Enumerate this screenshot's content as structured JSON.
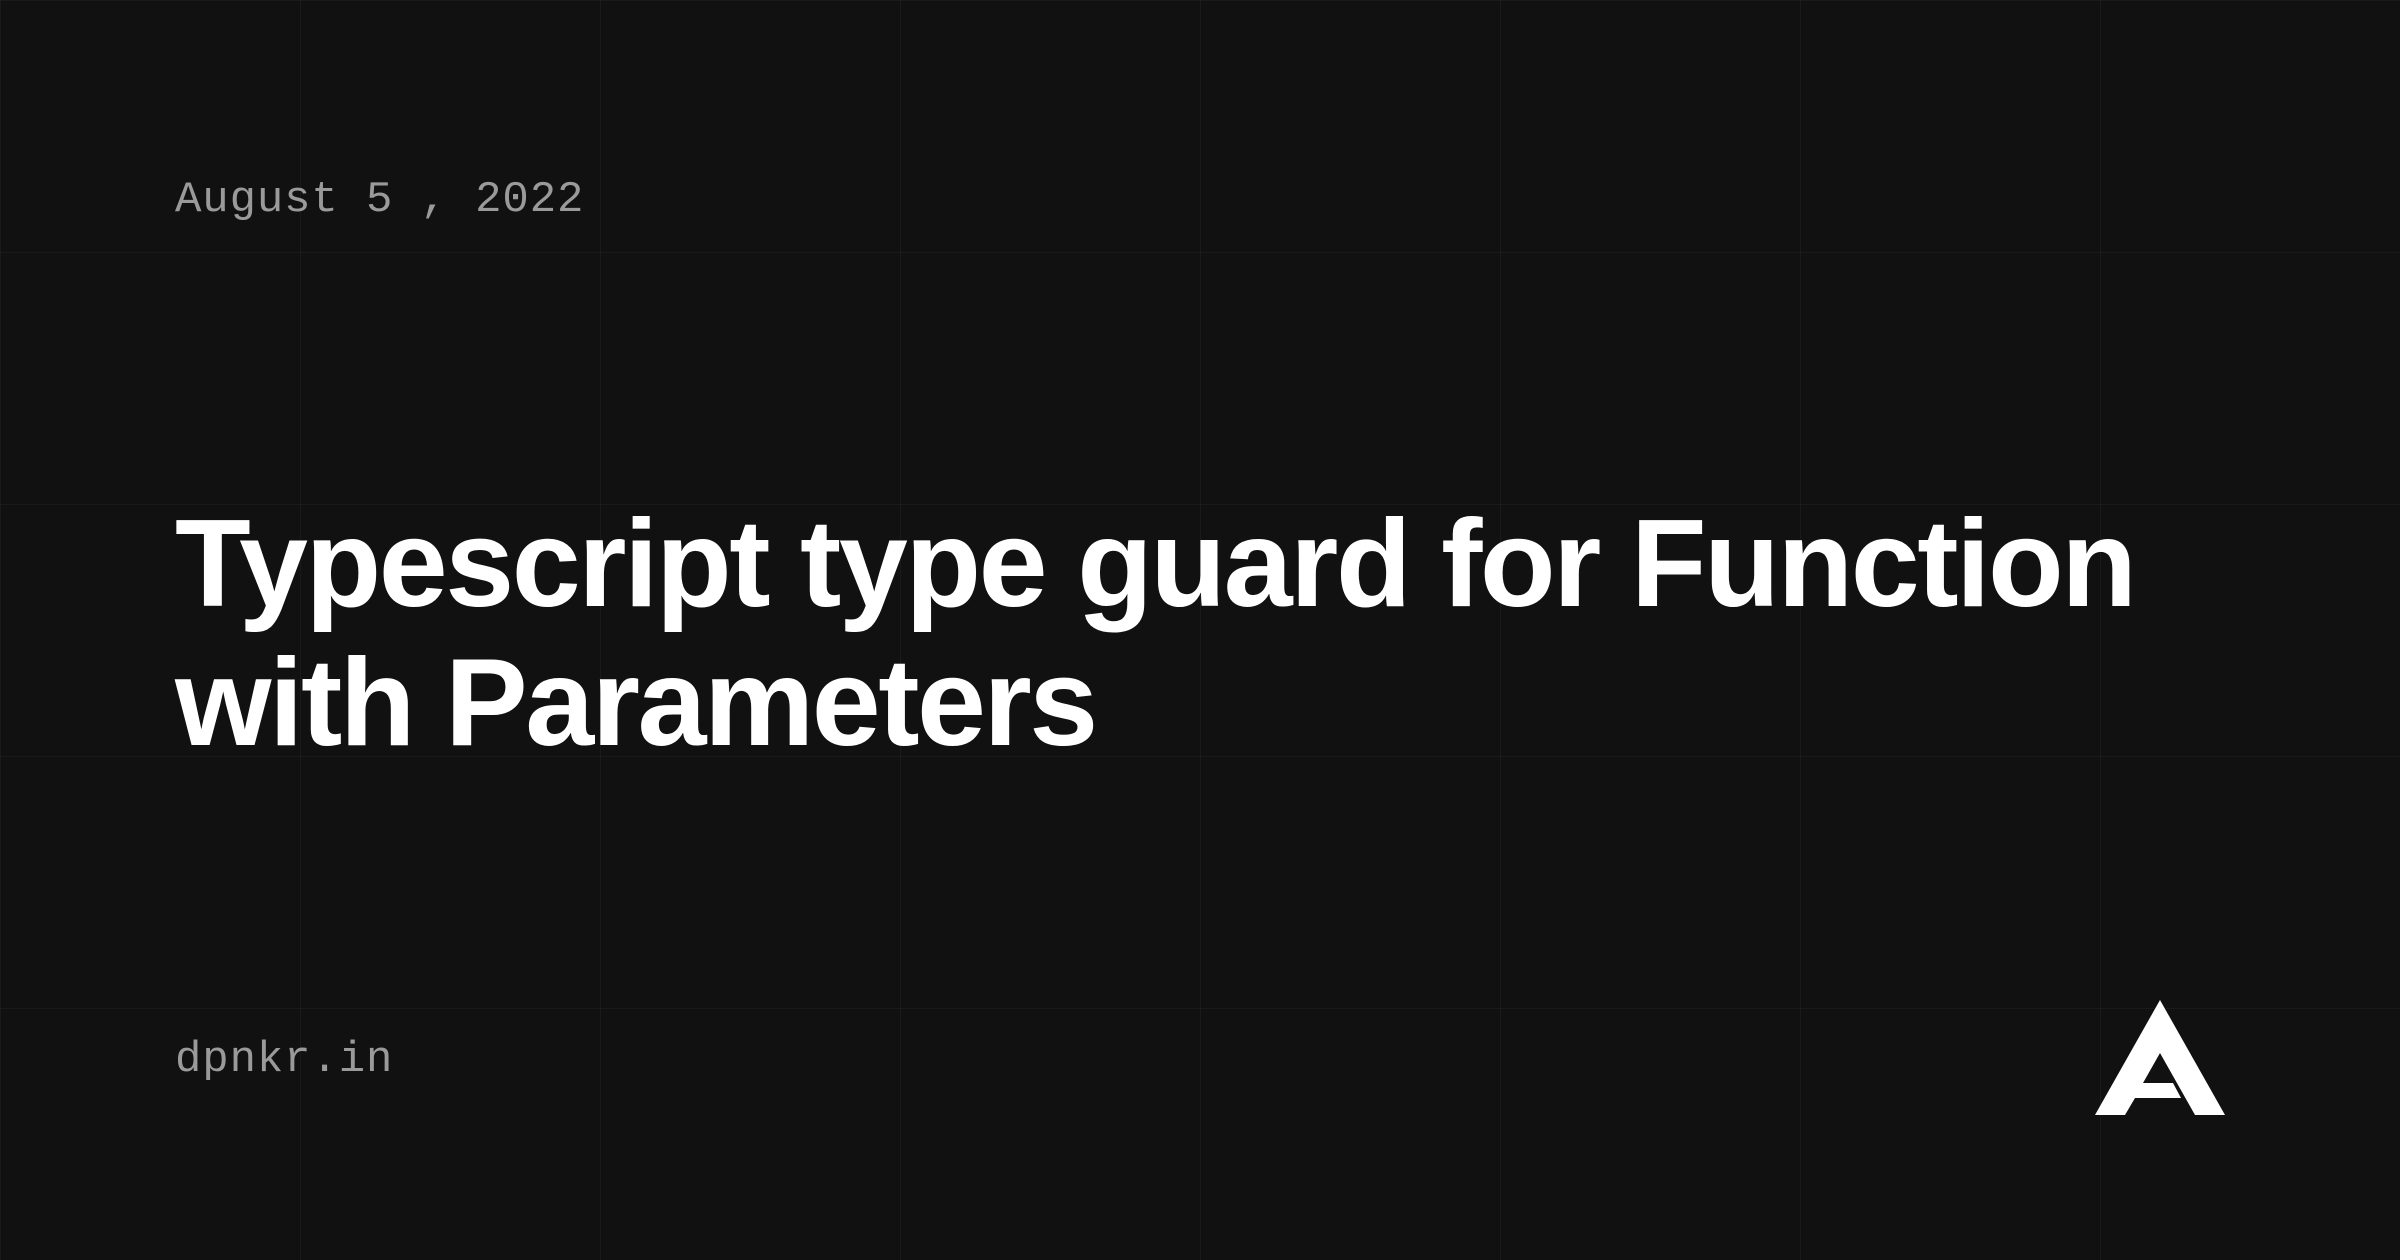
{
  "date": "August 5 , 2022",
  "title": "Typescript type guard for Function with Parameters",
  "site_url": "dpnkr.in"
}
